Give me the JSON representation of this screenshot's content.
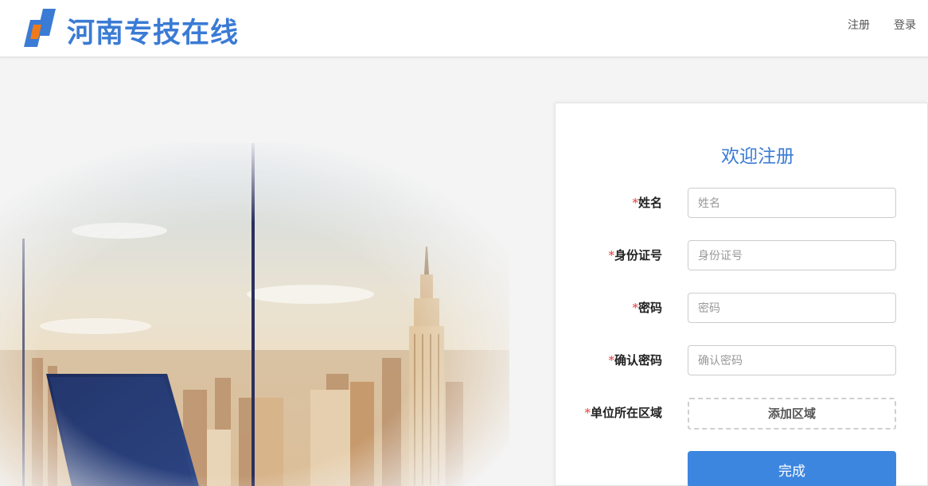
{
  "header": {
    "brand": "河南专技在线",
    "nav": {
      "register": "注册",
      "login": "登录"
    }
  },
  "form": {
    "title": "欢迎注册",
    "required_mark": "*",
    "fields": [
      {
        "label": "姓名",
        "placeholder": "姓名"
      },
      {
        "label": "身份证号",
        "placeholder": "身份证号"
      },
      {
        "label": "密码",
        "placeholder": "密码"
      },
      {
        "label": "确认密码",
        "placeholder": "确认密码"
      }
    ],
    "region": {
      "label": "单位所在区域",
      "button": "添加区域"
    },
    "submit": "完成"
  },
  "colors": {
    "accent": "#3a7bd5",
    "button": "#3d86e0",
    "required": "#e23b3b",
    "logo_orange": "#f07a1a"
  },
  "icons": {
    "logo": "brand-logo-icon"
  }
}
